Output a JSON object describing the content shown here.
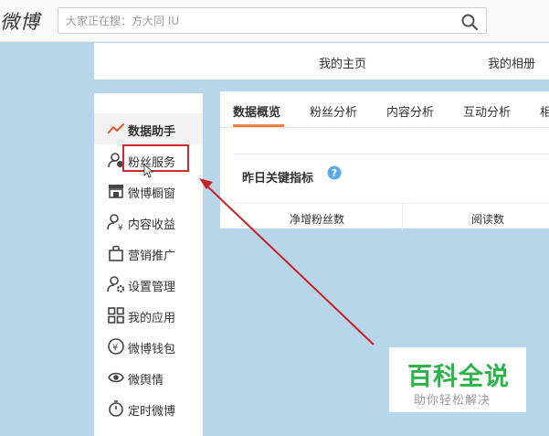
{
  "header": {
    "logo_text": "微博",
    "search_placeholder": "大家正在搜：方大同 IU",
    "search_icon": "search-icon"
  },
  "profile_nav": [
    "我的主页",
    "我的相册"
  ],
  "sidebar": {
    "items": [
      {
        "label": "数据助手",
        "icon": "chart-line-icon",
        "active": true
      },
      {
        "label": "粉丝服务",
        "icon": "fans-service-icon"
      },
      {
        "label": "微博橱窗",
        "icon": "shop-window-icon"
      },
      {
        "label": "内容收益",
        "icon": "content-revenue-icon"
      },
      {
        "label": "营销推广",
        "icon": "marketing-bag-icon"
      },
      {
        "label": "设置管理",
        "icon": "user-settings-icon"
      },
      {
        "label": "我的应用",
        "icon": "apps-grid-icon"
      },
      {
        "label": "微博钱包",
        "icon": "wallet-icon"
      },
      {
        "label": "微舆情",
        "icon": "public-opinion-icon"
      },
      {
        "label": "定时微博",
        "icon": "timer-icon"
      }
    ]
  },
  "tabs": [
    "数据概览",
    "粉丝分析",
    "内容分析",
    "互动分析",
    "相"
  ],
  "metrics": {
    "title": "昨日关键指标",
    "columns": [
      "净增粉丝数",
      "阅读数"
    ]
  },
  "watermark": {
    "main": "百科全说",
    "sub": "助你轻松解决"
  },
  "colors": {
    "accent": "#fa7d3c",
    "highlight": "#d2292e",
    "watermark_green": "#2cb34a",
    "help_blue": "#5aa9e6"
  }
}
